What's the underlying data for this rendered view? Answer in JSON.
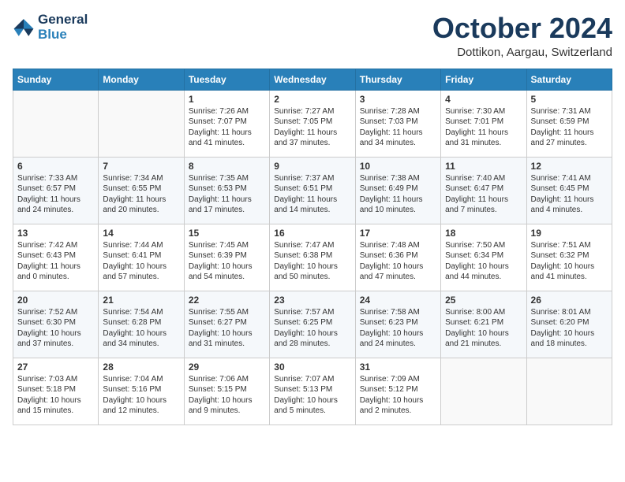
{
  "header": {
    "logo_line1": "General",
    "logo_line2": "Blue",
    "month": "October 2024",
    "location": "Dottikon, Aargau, Switzerland"
  },
  "weekdays": [
    "Sunday",
    "Monday",
    "Tuesday",
    "Wednesday",
    "Thursday",
    "Friday",
    "Saturday"
  ],
  "weeks": [
    [
      {
        "day": "",
        "sunrise": "",
        "sunset": "",
        "daylight": ""
      },
      {
        "day": "",
        "sunrise": "",
        "sunset": "",
        "daylight": ""
      },
      {
        "day": "1",
        "sunrise": "Sunrise: 7:26 AM",
        "sunset": "Sunset: 7:07 PM",
        "daylight": "Daylight: 11 hours and 41 minutes."
      },
      {
        "day": "2",
        "sunrise": "Sunrise: 7:27 AM",
        "sunset": "Sunset: 7:05 PM",
        "daylight": "Daylight: 11 hours and 37 minutes."
      },
      {
        "day": "3",
        "sunrise": "Sunrise: 7:28 AM",
        "sunset": "Sunset: 7:03 PM",
        "daylight": "Daylight: 11 hours and 34 minutes."
      },
      {
        "day": "4",
        "sunrise": "Sunrise: 7:30 AM",
        "sunset": "Sunset: 7:01 PM",
        "daylight": "Daylight: 11 hours and 31 minutes."
      },
      {
        "day": "5",
        "sunrise": "Sunrise: 7:31 AM",
        "sunset": "Sunset: 6:59 PM",
        "daylight": "Daylight: 11 hours and 27 minutes."
      }
    ],
    [
      {
        "day": "6",
        "sunrise": "Sunrise: 7:33 AM",
        "sunset": "Sunset: 6:57 PM",
        "daylight": "Daylight: 11 hours and 24 minutes."
      },
      {
        "day": "7",
        "sunrise": "Sunrise: 7:34 AM",
        "sunset": "Sunset: 6:55 PM",
        "daylight": "Daylight: 11 hours and 20 minutes."
      },
      {
        "day": "8",
        "sunrise": "Sunrise: 7:35 AM",
        "sunset": "Sunset: 6:53 PM",
        "daylight": "Daylight: 11 hours and 17 minutes."
      },
      {
        "day": "9",
        "sunrise": "Sunrise: 7:37 AM",
        "sunset": "Sunset: 6:51 PM",
        "daylight": "Daylight: 11 hours and 14 minutes."
      },
      {
        "day": "10",
        "sunrise": "Sunrise: 7:38 AM",
        "sunset": "Sunset: 6:49 PM",
        "daylight": "Daylight: 11 hours and 10 minutes."
      },
      {
        "day": "11",
        "sunrise": "Sunrise: 7:40 AM",
        "sunset": "Sunset: 6:47 PM",
        "daylight": "Daylight: 11 hours and 7 minutes."
      },
      {
        "day": "12",
        "sunrise": "Sunrise: 7:41 AM",
        "sunset": "Sunset: 6:45 PM",
        "daylight": "Daylight: 11 hours and 4 minutes."
      }
    ],
    [
      {
        "day": "13",
        "sunrise": "Sunrise: 7:42 AM",
        "sunset": "Sunset: 6:43 PM",
        "daylight": "Daylight: 11 hours and 0 minutes."
      },
      {
        "day": "14",
        "sunrise": "Sunrise: 7:44 AM",
        "sunset": "Sunset: 6:41 PM",
        "daylight": "Daylight: 10 hours and 57 minutes."
      },
      {
        "day": "15",
        "sunrise": "Sunrise: 7:45 AM",
        "sunset": "Sunset: 6:39 PM",
        "daylight": "Daylight: 10 hours and 54 minutes."
      },
      {
        "day": "16",
        "sunrise": "Sunrise: 7:47 AM",
        "sunset": "Sunset: 6:38 PM",
        "daylight": "Daylight: 10 hours and 50 minutes."
      },
      {
        "day": "17",
        "sunrise": "Sunrise: 7:48 AM",
        "sunset": "Sunset: 6:36 PM",
        "daylight": "Daylight: 10 hours and 47 minutes."
      },
      {
        "day": "18",
        "sunrise": "Sunrise: 7:50 AM",
        "sunset": "Sunset: 6:34 PM",
        "daylight": "Daylight: 10 hours and 44 minutes."
      },
      {
        "day": "19",
        "sunrise": "Sunrise: 7:51 AM",
        "sunset": "Sunset: 6:32 PM",
        "daylight": "Daylight: 10 hours and 41 minutes."
      }
    ],
    [
      {
        "day": "20",
        "sunrise": "Sunrise: 7:52 AM",
        "sunset": "Sunset: 6:30 PM",
        "daylight": "Daylight: 10 hours and 37 minutes."
      },
      {
        "day": "21",
        "sunrise": "Sunrise: 7:54 AM",
        "sunset": "Sunset: 6:28 PM",
        "daylight": "Daylight: 10 hours and 34 minutes."
      },
      {
        "day": "22",
        "sunrise": "Sunrise: 7:55 AM",
        "sunset": "Sunset: 6:27 PM",
        "daylight": "Daylight: 10 hours and 31 minutes."
      },
      {
        "day": "23",
        "sunrise": "Sunrise: 7:57 AM",
        "sunset": "Sunset: 6:25 PM",
        "daylight": "Daylight: 10 hours and 28 minutes."
      },
      {
        "day": "24",
        "sunrise": "Sunrise: 7:58 AM",
        "sunset": "Sunset: 6:23 PM",
        "daylight": "Daylight: 10 hours and 24 minutes."
      },
      {
        "day": "25",
        "sunrise": "Sunrise: 8:00 AM",
        "sunset": "Sunset: 6:21 PM",
        "daylight": "Daylight: 10 hours and 21 minutes."
      },
      {
        "day": "26",
        "sunrise": "Sunrise: 8:01 AM",
        "sunset": "Sunset: 6:20 PM",
        "daylight": "Daylight: 10 hours and 18 minutes."
      }
    ],
    [
      {
        "day": "27",
        "sunrise": "Sunrise: 7:03 AM",
        "sunset": "Sunset: 5:18 PM",
        "daylight": "Daylight: 10 hours and 15 minutes."
      },
      {
        "day": "28",
        "sunrise": "Sunrise: 7:04 AM",
        "sunset": "Sunset: 5:16 PM",
        "daylight": "Daylight: 10 hours and 12 minutes."
      },
      {
        "day": "29",
        "sunrise": "Sunrise: 7:06 AM",
        "sunset": "Sunset: 5:15 PM",
        "daylight": "Daylight: 10 hours and 9 minutes."
      },
      {
        "day": "30",
        "sunrise": "Sunrise: 7:07 AM",
        "sunset": "Sunset: 5:13 PM",
        "daylight": "Daylight: 10 hours and 5 minutes."
      },
      {
        "day": "31",
        "sunrise": "Sunrise: 7:09 AM",
        "sunset": "Sunset: 5:12 PM",
        "daylight": "Daylight: 10 hours and 2 minutes."
      },
      {
        "day": "",
        "sunrise": "",
        "sunset": "",
        "daylight": ""
      },
      {
        "day": "",
        "sunrise": "",
        "sunset": "",
        "daylight": ""
      }
    ]
  ]
}
